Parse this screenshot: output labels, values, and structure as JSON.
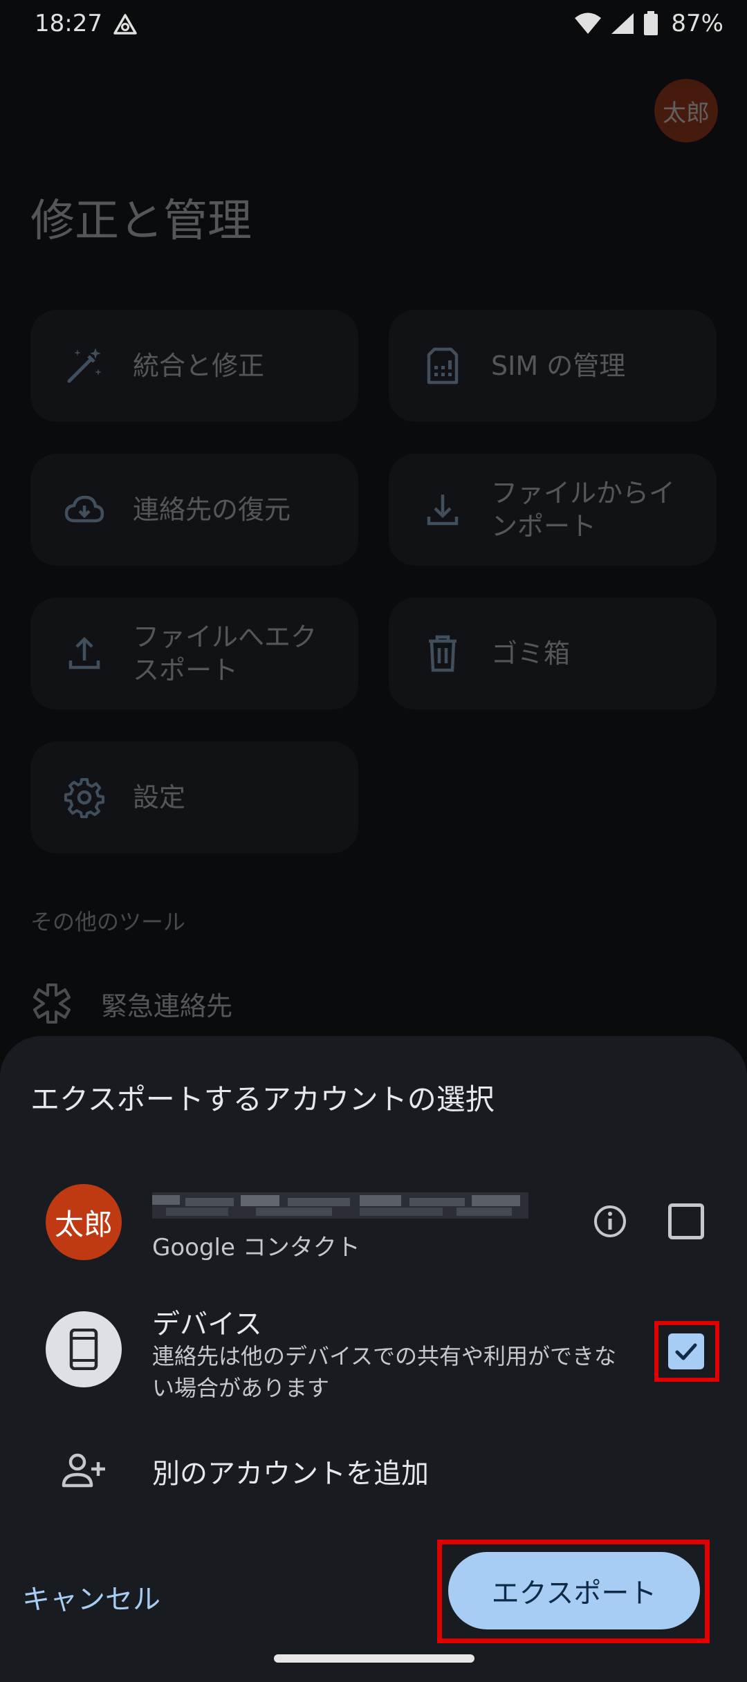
{
  "status_bar": {
    "time": "18:27",
    "battery": "87%",
    "icons": [
      "app-notification-icon",
      "wifi-icon",
      "signal-icon",
      "battery-icon"
    ]
  },
  "background_page": {
    "avatar_text": "太郎",
    "title": "修正と管理",
    "tiles": [
      {
        "label": "統合と修正",
        "icon": "magic-wand-icon"
      },
      {
        "label": "SIM の管理",
        "icon": "sim-card-icon"
      },
      {
        "label": "連絡先の復元",
        "icon": "cloud-download-icon"
      },
      {
        "label": "ファイルからインポート",
        "icon": "download-icon"
      },
      {
        "label": "ファイルへエクスポート",
        "icon": "upload-icon"
      },
      {
        "label": "ゴミ箱",
        "icon": "trash-icon"
      },
      {
        "label": "設定",
        "icon": "gear-icon"
      }
    ],
    "other_tools_label": "その他のツール",
    "emergency_label": "緊急連絡先"
  },
  "sheet": {
    "title": "エクスポートするアカウントの選択",
    "google_account": {
      "avatar_text": "太郎",
      "subtitle": "Google コンタクト",
      "checked": false
    },
    "device": {
      "title": "デバイス",
      "description": "連絡先は他のデバイスでの共有や利用ができない場合があります",
      "checked": true
    },
    "add_account_label": "別のアカウントを追加",
    "cancel_label": "キャンセル",
    "export_label": "エクスポート"
  },
  "colors": {
    "accent": "#a7cdf5",
    "avatar": "#bf3a12",
    "highlight": "#e00000",
    "sheet_bg": "#181c21"
  }
}
